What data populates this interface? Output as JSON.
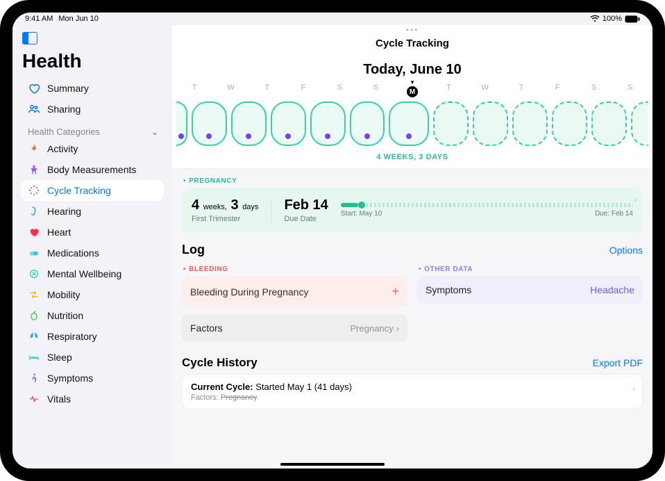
{
  "status": {
    "time": "9:41 AM",
    "date": "Mon Jun 10",
    "battery": "100%"
  },
  "app": {
    "title": "Health"
  },
  "nav": {
    "summary": "Summary",
    "sharing": "Sharing",
    "categories_header": "Health Categories",
    "activity": "Activity",
    "body": "Body Measurements",
    "cycle": "Cycle Tracking",
    "hearing": "Hearing",
    "heart": "Heart",
    "medications": "Medications",
    "mental": "Mental Wellbeing",
    "mobility": "Mobility",
    "nutrition": "Nutrition",
    "respiratory": "Respiratory",
    "sleep": "Sleep",
    "symptoms": "Symptoms",
    "vitals": "Vitals"
  },
  "main": {
    "page_title": "Cycle Tracking",
    "today_label": "Today, June 10",
    "day_letters": [
      "T",
      "W",
      "T",
      "F",
      "S",
      "S",
      "M",
      "T",
      "W",
      "T",
      "F",
      "S",
      "S"
    ],
    "today_index": 6,
    "duration_strip": "4 WEEKS, 3 DAYS"
  },
  "pregnancy": {
    "tag": "PREGNANCY",
    "weeks_num": "4",
    "weeks_label": "weeks,",
    "days_num": "3",
    "days_label": "days",
    "trimester": "First Trimester",
    "due_value": "Feb 14",
    "due_label": "Due Date",
    "start_text": "Start: May 10",
    "due_text": "Due: Feb 14"
  },
  "log": {
    "title": "Log",
    "options": "Options",
    "bleeding_tag": "BLEEDING",
    "bleeding_card": "Bleeding During Pregnancy",
    "factors_label": "Factors",
    "factors_value": "Pregnancy",
    "other_tag": "OTHER DATA",
    "symptoms_label": "Symptoms",
    "symptoms_value": "Headache"
  },
  "history": {
    "title": "Cycle History",
    "export": "Export PDF",
    "current_label": "Current Cycle:",
    "current_value": "Started May 1 (41 days)",
    "factors_label": "Factors:",
    "factors_value": "Pregnancy"
  }
}
